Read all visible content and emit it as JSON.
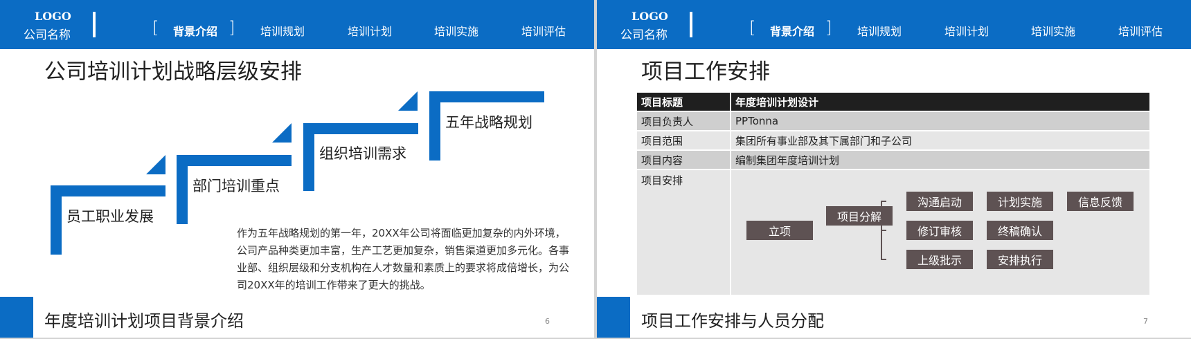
{
  "header": {
    "logo": "LOGO",
    "company": "公司名称",
    "nav": [
      "背景介绍",
      "培训规划",
      "培训计划",
      "培训实施",
      "培训评估"
    ],
    "bracket_left": "[",
    "bracket_right": "]"
  },
  "slide1": {
    "title": "公司培训计划战略层级安排",
    "steps": [
      "员工职业发展",
      "部门培训重点",
      "组织培训需求",
      "五年战略规划"
    ],
    "paragraph": "作为五年战略规划的第一年，20XX年公司将面临更加复杂的内外环境，公司产品种类更加丰富，生产工艺更加复杂，销售渠道更加多元化。各事业部、组织层级和分支机构在人才数量和素质上的要求将成倍增长，为公司20XX年的培训工作带来了更大的挑战。",
    "footer_title": "年度培训计划项目背景介绍",
    "page_number": "6"
  },
  "slide2": {
    "title": "项目工作安排",
    "table": {
      "header": [
        "项目标题",
        "年度培训计划设计"
      ],
      "rows": [
        [
          "项目负责人",
          "PPTonna"
        ],
        [
          "项目范围",
          "集团所有事业部及其下属部门和子公司"
        ],
        [
          "项目内容",
          "编制集团年度培训计划"
        ],
        [
          "项目安排",
          ""
        ]
      ]
    },
    "flow": {
      "start": "立项",
      "decompose": "项目分解",
      "branches": [
        [
          "沟通启动",
          "计划实施",
          "信息反馈"
        ],
        [
          "修订审核",
          "终稿确认"
        ],
        [
          "上级批示",
          "安排执行"
        ]
      ]
    },
    "footer_title": "项目工作安排与人员分配",
    "page_number": "7",
    "colors": {
      "brand": "#0b6cc4",
      "node": "#5e5253",
      "table_head": "#1f1f1f"
    }
  }
}
